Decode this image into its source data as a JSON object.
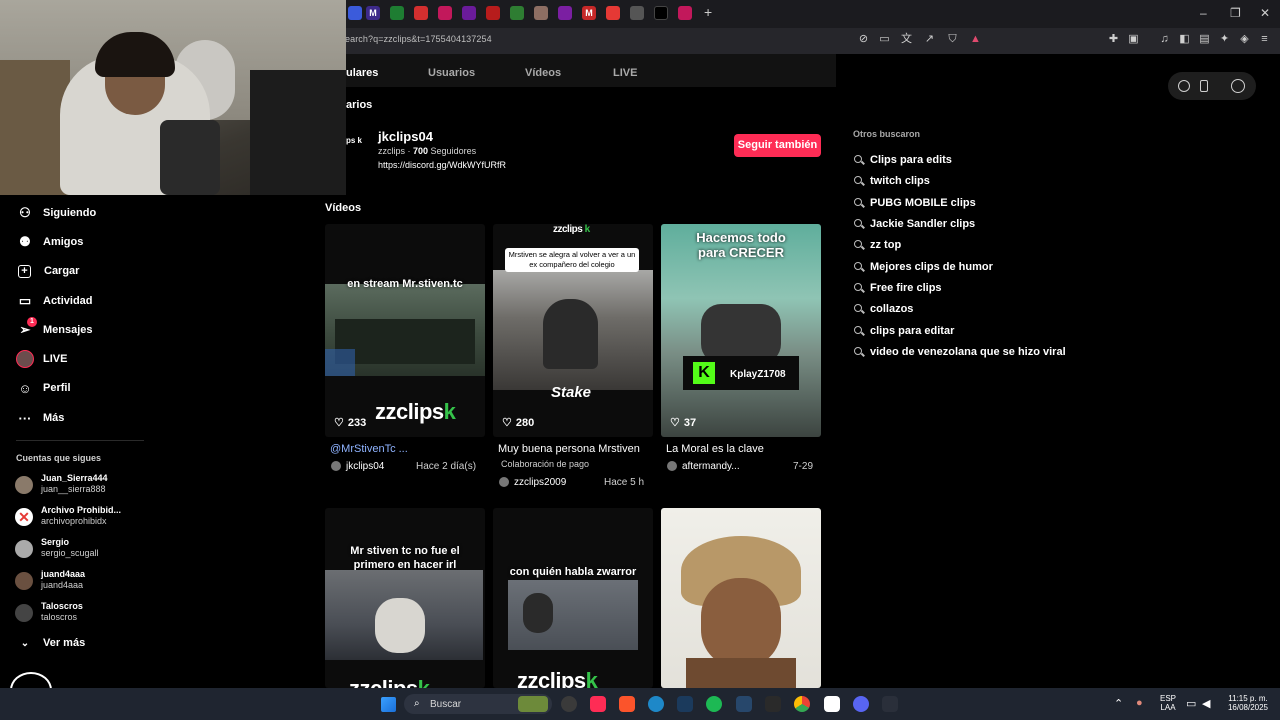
{
  "browser": {
    "url": "earch?q=zzclips&t=1755404137254",
    "new_tab": "+",
    "window_controls": [
      "–",
      "❐",
      "✕"
    ]
  },
  "tabs": [
    "Usuarios",
    "Vídeos",
    "LIVE"
  ],
  "active_tab_partial": "ulares",
  "section_users_partial": "arios",
  "account": {
    "logo_partial": "ps k",
    "name": "jkclips04",
    "handle": "zzclips · ",
    "followers_count": "700",
    "followers_label": " Seguidores",
    "link": "https://discord.gg/WdkWYfURfR",
    "follow_button": "Seguir también"
  },
  "videos_title": "Vídeos",
  "sidebar": {
    "items": [
      {
        "label": "Siguiendo",
        "icon": "following-icon"
      },
      {
        "label": "Amigos",
        "icon": "friends-icon"
      },
      {
        "label": "Cargar",
        "icon": "upload-icon"
      },
      {
        "label": "Actividad",
        "icon": "activity-icon"
      },
      {
        "label": "Mensajes",
        "icon": "messages-icon",
        "badge": "1"
      },
      {
        "label": "LIVE",
        "icon": "live-icon"
      },
      {
        "label": "Perfil",
        "icon": "profile-icon"
      },
      {
        "label": "Más",
        "icon": "more-icon"
      }
    ],
    "following_title": "Cuentas que sigues",
    "following": [
      {
        "name": "Juan_Sierra444",
        "handle": "juan__sierra888"
      },
      {
        "name": "Archivo Prohibid...",
        "handle": "archivoprohibidx"
      },
      {
        "name": "Sergio",
        "handle": "sergio_scugall"
      },
      {
        "name": "juand4aaa",
        "handle": "juand4aaa"
      },
      {
        "name": "Taloscros",
        "handle": "taloscros"
      }
    ],
    "see_more": "Ver más"
  },
  "videos": [
    {
      "overlay": "en stream Mr.stiven.tc",
      "brand": "zzclips",
      "brand_k": "k",
      "likes": "233",
      "caption": "@MrStivenTc ...",
      "author": "jkclips04",
      "time": "Hace 2 día(s)"
    },
    {
      "overlay_top": "zzclips",
      "overlay_top_k": "k",
      "overlay": "Mrstiven se alegra al volver a ver a un ex compañero del colegio",
      "watermark": "Stake",
      "likes": "280",
      "caption": "Muy buena persona Mrstiven",
      "sub": "Colaboración de pago",
      "author": "zzclips2009",
      "time": "Hace 5 h"
    },
    {
      "overlay": "Hacemos todo para CRECER",
      "badge": "KplayZ1708",
      "likes": "37",
      "caption": "La Moral es la clave",
      "author": "aftermandy...",
      "time": "7-29"
    },
    {
      "overlay": "Mr stiven tc no fue el primero en hacer irl",
      "brand": "zzclips",
      "brand_k": "k"
    },
    {
      "overlay": "con quién habla zwarror",
      "brand": "zzclips",
      "brand_k": "k"
    },
    {}
  ],
  "other_searches": {
    "title": "Otros buscaron",
    "items": [
      "Clips para edits",
      "twitch clips",
      "PUBG MOBILE clips",
      "Jackie Sandler clips",
      "zz top",
      "Mejores clips de humor",
      "Free fire clips",
      "collazos",
      "clips para editar",
      "video de venezolana que se hizo viral"
    ]
  },
  "taskbar": {
    "search_label": "Buscar",
    "lang": "ESP",
    "lang2": "LAA",
    "time": "11:15 p. m.",
    "date": "16/08/2025"
  },
  "colors": {
    "accent": "#fe2c55",
    "brand_green": "#35c24a"
  }
}
